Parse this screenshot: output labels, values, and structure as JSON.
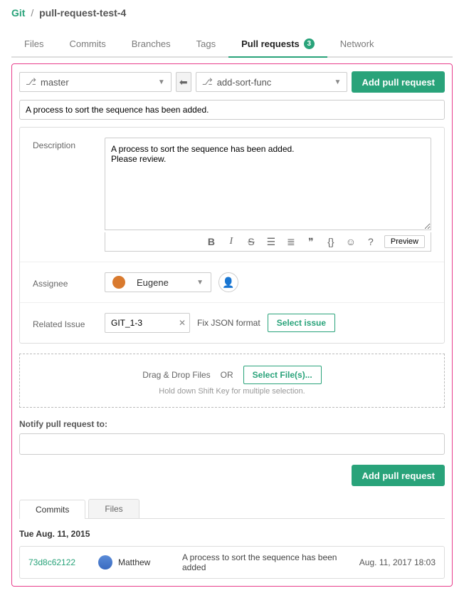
{
  "breadcrumb": {
    "repo": "Git",
    "page": "pull-request-test-4"
  },
  "nav": {
    "files": "Files",
    "commits": "Commits",
    "branches": "Branches",
    "tags": "Tags",
    "pull_requests": "Pull requests",
    "pull_requests_badge": "3",
    "network": "Network"
  },
  "pr_form": {
    "base_branch": "master",
    "compare_branch": "add-sort-func",
    "add_button": "Add pull request",
    "title_value": "A process to sort the sequence has been added.",
    "description_label": "Description",
    "description_value": "A process to sort the sequence has been added.\nPlease review.",
    "preview_btn": "Preview",
    "assignee_label": "Assignee",
    "assignee_value": "Eugene",
    "related_issue_label": "Related Issue",
    "related_issue_key": "GIT_1-3",
    "related_issue_title": "Fix JSON format",
    "select_issue_btn": "Select issue"
  },
  "dropzone": {
    "drag_text": "Drag & Drop Files",
    "or_text": "OR",
    "select_btn": "Select File(s)...",
    "hint": "Hold down Shift Key for multiple selection."
  },
  "notify": {
    "label": "Notify pull request to:"
  },
  "bottom": {
    "add_button": "Add pull request"
  },
  "inner_tabs": {
    "commits": "Commits",
    "files": "Files"
  },
  "commit_group": {
    "date": "Tue Aug. 11, 2015",
    "row": {
      "sha": "73d8c62122",
      "author": "Matthew",
      "message": "A process to sort the sequence has been added",
      "time": "Aug. 11, 2017 18:03"
    }
  }
}
